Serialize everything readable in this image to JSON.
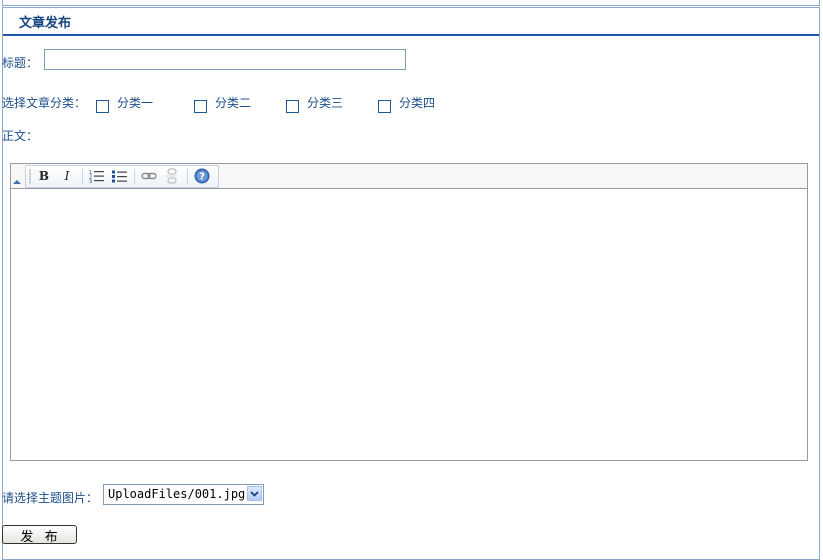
{
  "panel": {
    "title": "文章发布"
  },
  "form": {
    "title_label": "标题：",
    "title_value": "",
    "category_label": "选择文章分类：",
    "categories": [
      {
        "label": "分类一",
        "checked": false
      },
      {
        "label": "分类二",
        "checked": false
      },
      {
        "label": "分类三",
        "checked": false
      },
      {
        "label": "分类四",
        "checked": false
      }
    ],
    "body_label": "正文：",
    "image_label": "请选择主题图片：",
    "image_selected": "UploadFiles/001.jpg",
    "submit_label": "发  布"
  },
  "editor": {
    "toolbar": [
      {
        "name": "bold-button",
        "glyph": "B"
      },
      {
        "name": "italic-button",
        "glyph": "I"
      },
      {
        "name": "ordered-list-button",
        "icon": "ordered-list-icon"
      },
      {
        "name": "unordered-list-button",
        "icon": "unordered-list-icon"
      },
      {
        "name": "link-button",
        "icon": "link-icon"
      },
      {
        "name": "unlink-button",
        "icon": "unlink-icon"
      },
      {
        "name": "help-button",
        "icon": "help-icon"
      }
    ],
    "content": ""
  },
  "colors": {
    "label_text": "#1b4f8a",
    "header_border": "#1c5aa6",
    "panel_border": "#8aa8cc"
  }
}
